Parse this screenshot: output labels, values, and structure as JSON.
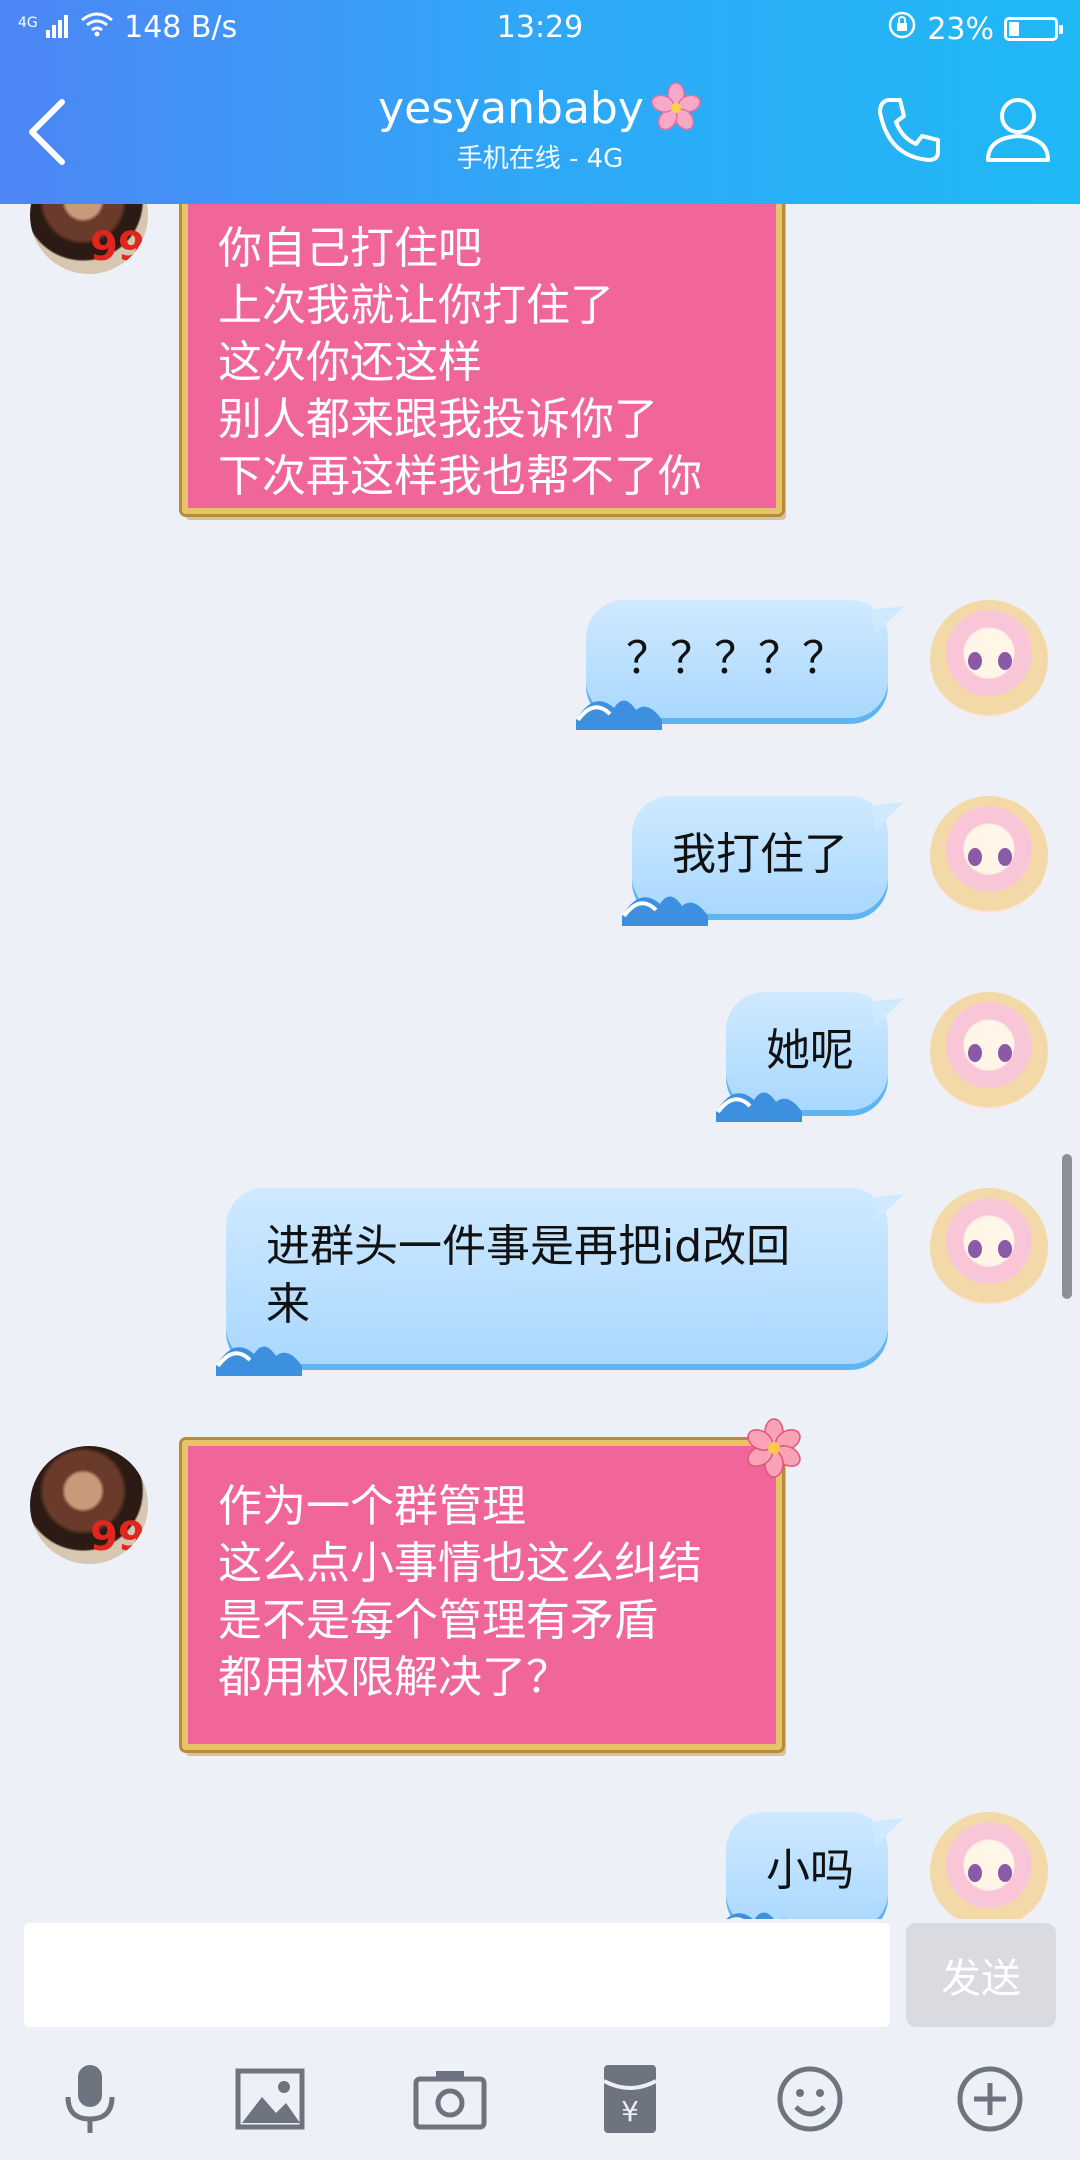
{
  "status_bar": {
    "network": "4G",
    "speed": "148 B/s",
    "time": "13:29",
    "battery": "23%",
    "battery_level": 0.23
  },
  "header": {
    "title": "yesyanbaby",
    "subtitle": "手机在线 - 4G"
  },
  "messages": [
    {
      "sender": "other",
      "lines": [
        "你自己打住吧",
        "上次我就让你打住了",
        "这次你还这样",
        "别人都来跟我投诉你了",
        "下次再这样我也帮不了你"
      ]
    },
    {
      "sender": "me",
      "lines": [
        "？？？？？"
      ]
    },
    {
      "sender": "me",
      "lines": [
        "我打住了"
      ]
    },
    {
      "sender": "me",
      "lines": [
        "她呢"
      ]
    },
    {
      "sender": "me",
      "lines": [
        "进群头一件事是再把id改回",
        "来"
      ]
    },
    {
      "sender": "other",
      "lines": [
        "作为一个群管理",
        "这么点小事情也这么纠结",
        "是不是每个管理有矛盾",
        "都用权限解决了？"
      ]
    },
    {
      "sender": "me",
      "lines": [
        "小吗"
      ]
    }
  ],
  "input": {
    "value": "",
    "send_label": "发送"
  },
  "colors": {
    "header_start": "#4d86f5",
    "header_end": "#1fb9f6",
    "pink_bubble": "#f1669a",
    "blue_bubble": "#a9d8ff"
  },
  "toolbar": [
    "mic-icon",
    "image-icon",
    "camera-icon",
    "red-packet-icon",
    "emoji-icon",
    "plus-icon"
  ]
}
